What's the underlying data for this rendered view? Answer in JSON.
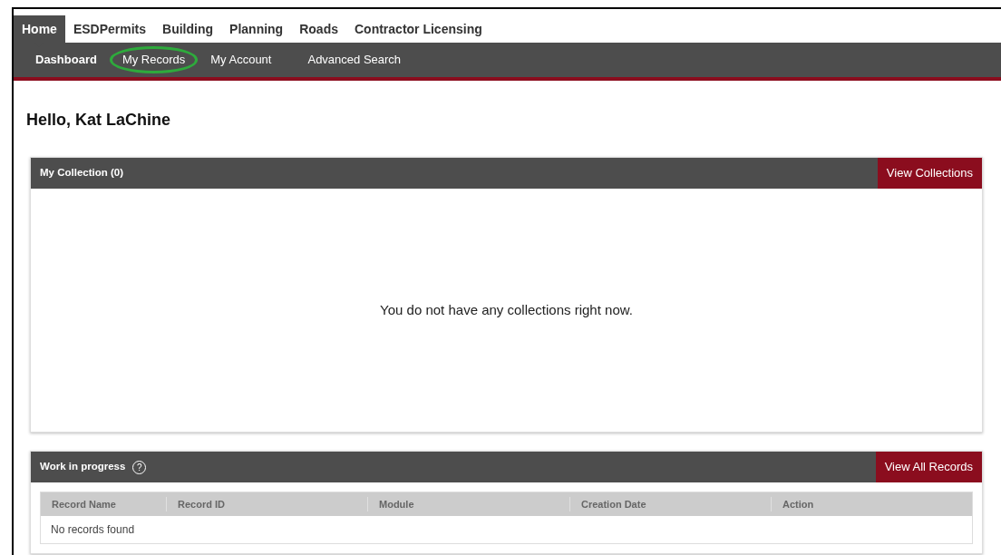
{
  "top_nav": [
    {
      "label": "Home",
      "selected": true
    },
    {
      "label": "ESDPermits",
      "selected": false
    },
    {
      "label": "Building",
      "selected": false
    },
    {
      "label": "Planning",
      "selected": false
    },
    {
      "label": "Roads",
      "selected": false
    },
    {
      "label": "Contractor Licensing",
      "selected": false
    }
  ],
  "sub_nav": [
    {
      "label": "Dashboard",
      "selected": true,
      "circled": false
    },
    {
      "label": "My Records",
      "selected": false,
      "circled": true
    },
    {
      "label": "My Account",
      "selected": false,
      "circled": false
    },
    {
      "label": "Advanced Search",
      "selected": false,
      "circled": false
    }
  ],
  "greeting": "Hello, Kat LaChine",
  "collection_panel": {
    "title": "My Collection (0)",
    "button": "View Collections",
    "empty_message": "You do not have any collections right now."
  },
  "work_panel": {
    "title": "Work in progress",
    "help_icon": "?",
    "button": "View All Records",
    "table": {
      "columns": [
        "Record Name",
        "Record ID",
        "Module",
        "Creation Date",
        "Action"
      ],
      "empty_message": "No records found"
    }
  }
}
